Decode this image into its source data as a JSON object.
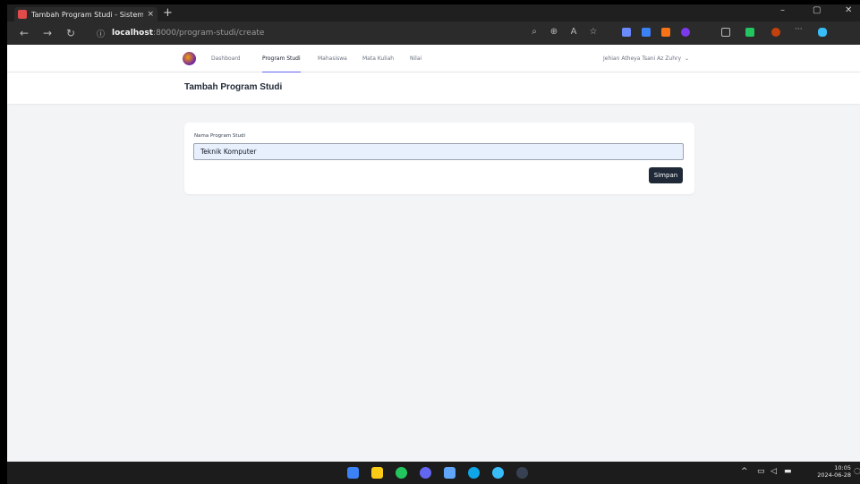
{
  "browser": {
    "tab_title": "Tambah Program Studi - Sistemi",
    "url_host": "localhost",
    "url_path": ":8000/program-studi/create",
    "new_tab": "+",
    "close_tab": "×",
    "minimize": "–",
    "maximize": "▢",
    "close": "✕"
  },
  "nav": {
    "items": [
      {
        "label": "Dashboard"
      },
      {
        "label": "Program Studi",
        "active": true
      },
      {
        "label": "Mahasiswa"
      },
      {
        "label": "Mata Kuliah"
      },
      {
        "label": "Nilai"
      }
    ],
    "user": "Jehian Atheya Tsani Az Zuhry"
  },
  "header": {
    "title": "Tambah Program Studi"
  },
  "form": {
    "field_label": "Nama Program Studi",
    "field_value": "Teknik Komputer",
    "submit_label": "Simpan"
  },
  "taskbar": {
    "time": "10:05",
    "date": "2024-06-28"
  },
  "colors": {
    "accent": "#6366f1",
    "button": "#1f2937",
    "input_bg": "#e8f0fe"
  }
}
